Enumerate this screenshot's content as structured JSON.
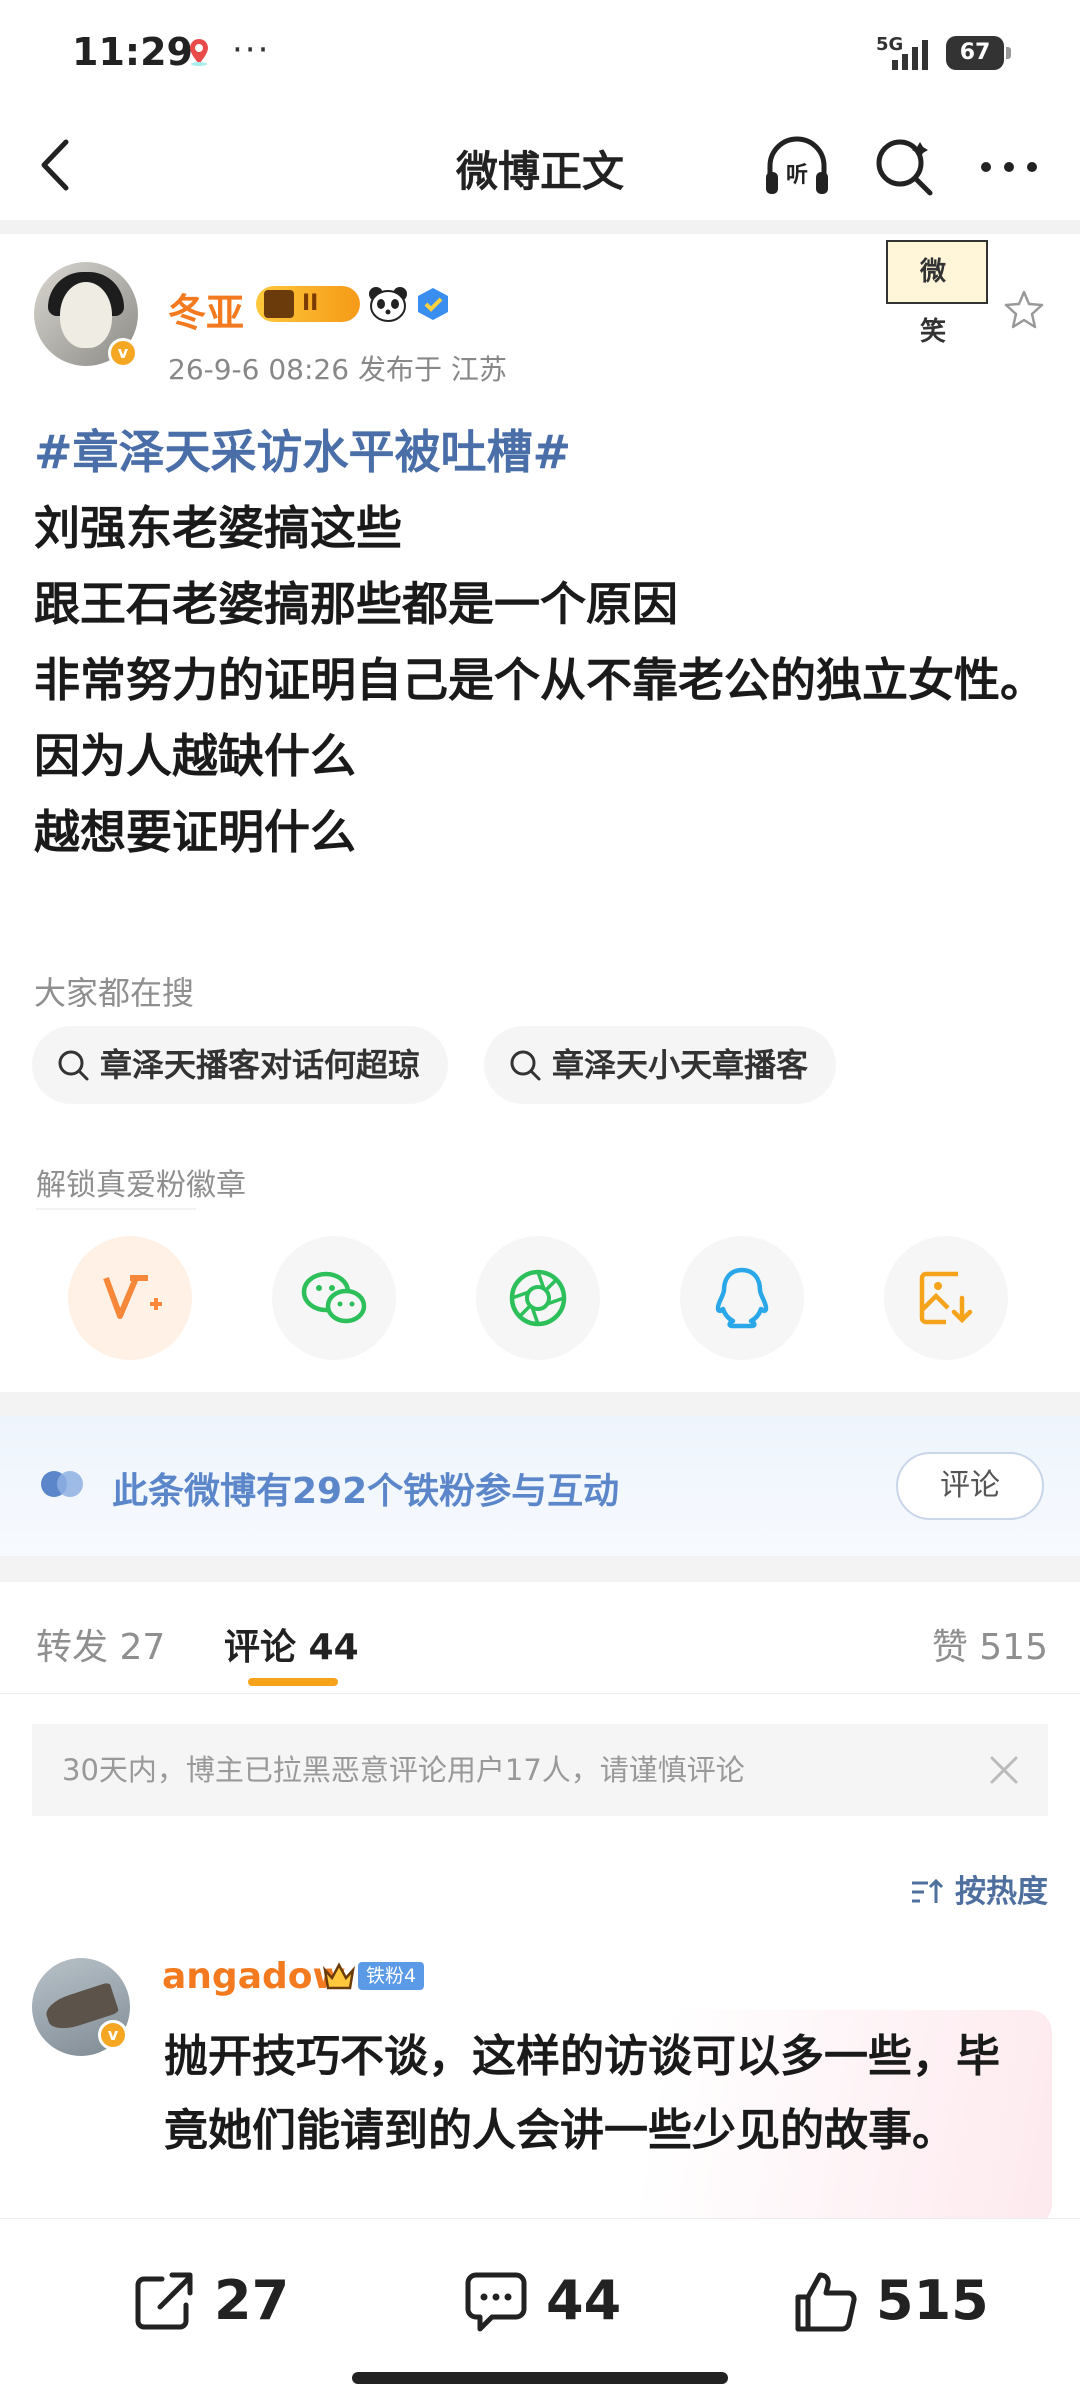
{
  "status_bar": {
    "time": "11:29",
    "dots": "···",
    "network": "5G",
    "battery": "67"
  },
  "header": {
    "title": "微博正文"
  },
  "post": {
    "author": "冬亚",
    "level": "II",
    "meta": "26-9-6 08:26  发布于 江苏",
    "sticker_text": "微笑",
    "hashtag": "#章泽天采访水平被吐槽#",
    "lines": "刘强东老婆搞这些\n跟王石老婆搞那些都是一个原因\n非常努力的证明自己是个从不靠老公的独立女性。\n因为人越缺什么\n越想要证明什么"
  },
  "hot_search": {
    "title": "大家都在搜",
    "chips": [
      "章泽天播客对话何超琼",
      "章泽天小天章播客"
    ]
  },
  "unlock": {
    "label": "解锁真爱粉徽章"
  },
  "share_icons": [
    "vplus-icon",
    "wechat-icon",
    "moments-icon",
    "qq-icon",
    "save-image-icon"
  ],
  "fans_banner": {
    "text": "此条微博有292个铁粉参与互动",
    "button": "评论"
  },
  "tabs": {
    "repost": "转发 27",
    "comment": "评论 44",
    "like": "赞 515"
  },
  "notice": {
    "text": "30天内，博主已拉黑恶意评论用户17人，请谨慎评论"
  },
  "sort": {
    "label": "按热度"
  },
  "comment": {
    "user": "angadow",
    "fan_badge": "铁粉4",
    "text": "抛开技巧不谈，这样的访谈可以多一些，毕竟她们能请到的人会讲一些少见的故事。"
  },
  "bottom_bar": {
    "repost": "27",
    "comment": "44",
    "like": "515"
  },
  "colors": {
    "accent_orange": "#f47a20",
    "link_blue": "#4a6ea8",
    "tab_underline": "#f5a31b"
  }
}
